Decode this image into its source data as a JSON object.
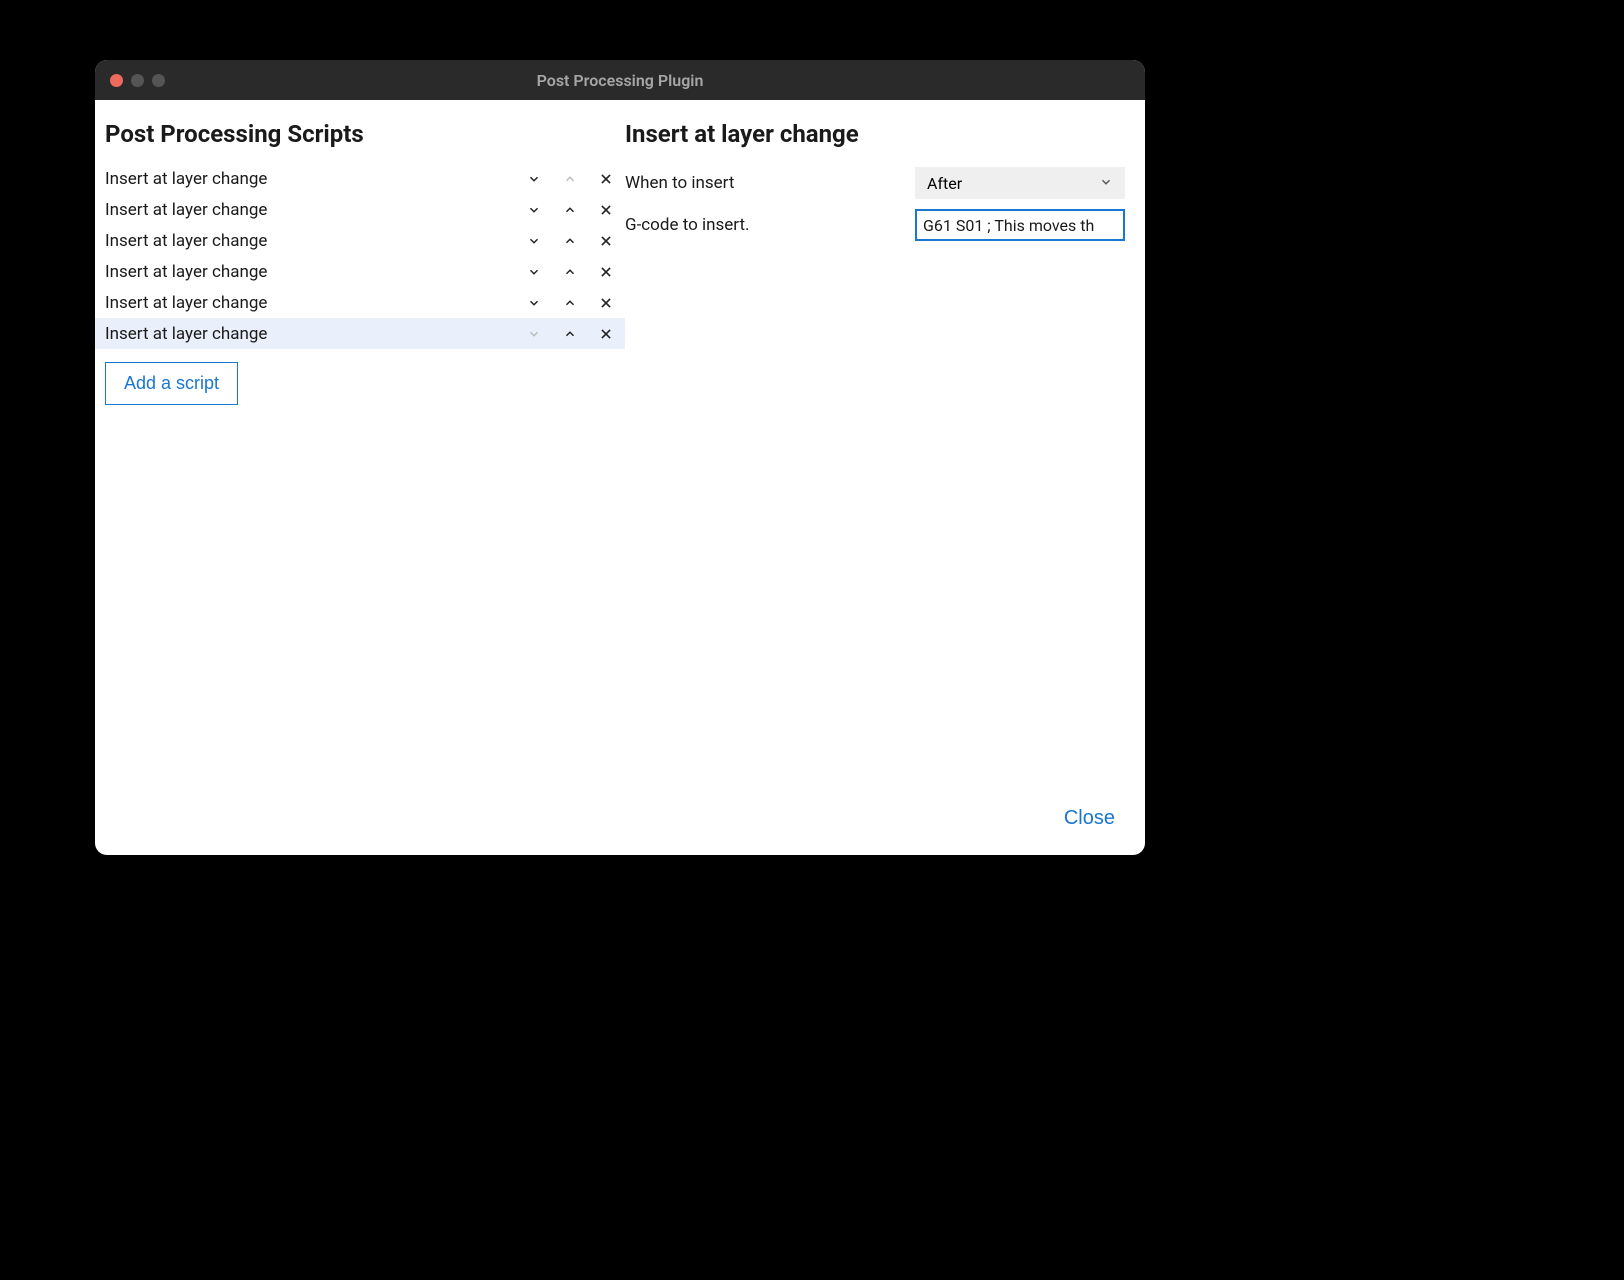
{
  "window": {
    "title": "Post Processing Plugin"
  },
  "left": {
    "heading": "Post Processing Scripts",
    "scripts": [
      {
        "name": "Insert at layer change",
        "down": true,
        "up": false,
        "selected": false
      },
      {
        "name": "Insert at layer change",
        "down": true,
        "up": true,
        "selected": false
      },
      {
        "name": "Insert at layer change",
        "down": true,
        "up": true,
        "selected": false
      },
      {
        "name": "Insert at layer change",
        "down": true,
        "up": true,
        "selected": false
      },
      {
        "name": "Insert at layer change",
        "down": true,
        "up": true,
        "selected": false
      },
      {
        "name": "Insert at layer change",
        "down": false,
        "up": true,
        "selected": true
      }
    ],
    "add_label": "Add a script"
  },
  "right": {
    "heading": "Insert at layer change",
    "fields": {
      "when_label": "When to insert",
      "when_value": "After",
      "gcode_label": "G-code to insert.",
      "gcode_value": "G61 S01 ; This moves th"
    }
  },
  "footer": {
    "close_label": "Close"
  }
}
